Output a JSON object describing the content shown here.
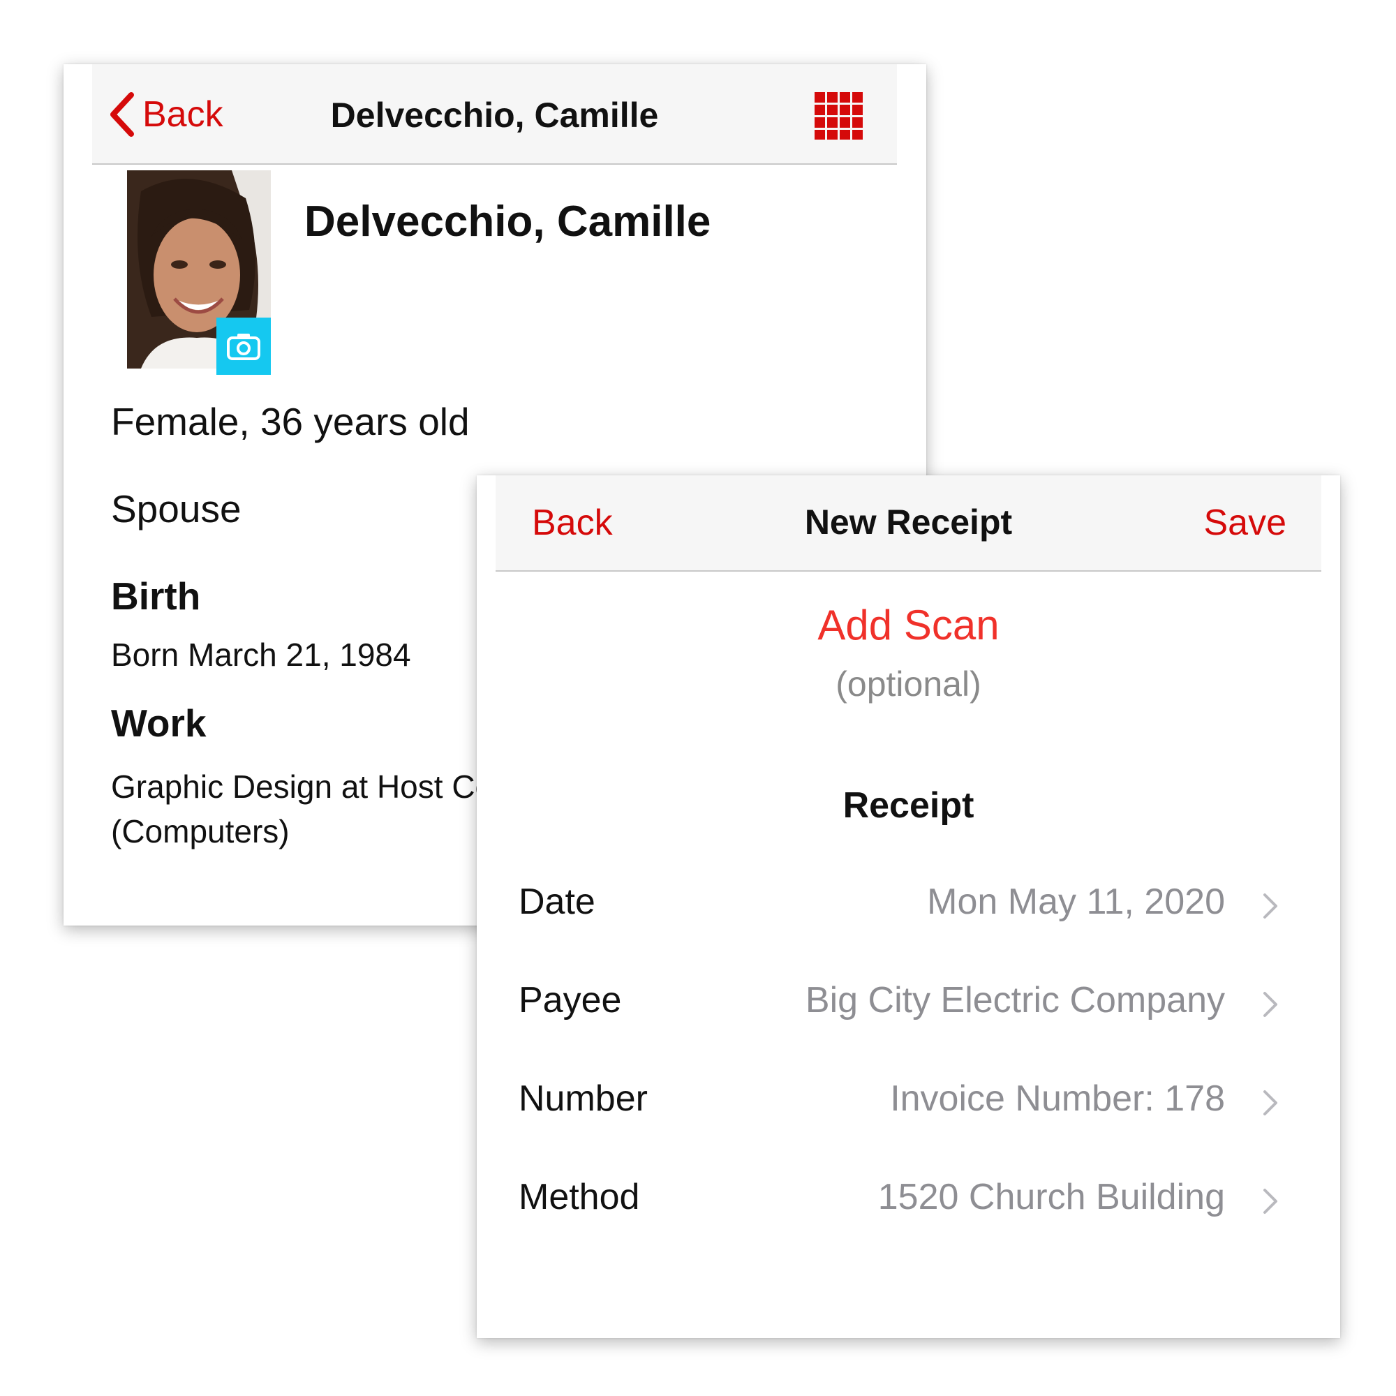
{
  "profile": {
    "navbar": {
      "back_label": "Back",
      "title": "Delvecchio, Camille",
      "menu_icon": "grid-icon"
    },
    "name": "Delvecchio, Camille",
    "gender_age": "Female, 36 years old",
    "relationship": "Spouse",
    "birth": {
      "heading": "Birth",
      "text": "Born March 21, 1984"
    },
    "work": {
      "heading": "Work",
      "line1": "Graphic Design at Host Computers",
      "line2": "(Computers)"
    }
  },
  "receipt": {
    "navbar": {
      "back_label": "Back",
      "title": "New Receipt",
      "save_label": "Save"
    },
    "add_scan": "Add Scan",
    "optional": "(optional)",
    "section_title": "Receipt",
    "rows": [
      {
        "label": "Date",
        "value": "Mon May 11, 2020"
      },
      {
        "label": "Payee",
        "value": "Big City Electric Company"
      },
      {
        "label": "Number",
        "value": "Invoice Number: 178"
      },
      {
        "label": "Method",
        "value": "1520 Church Building"
      }
    ]
  },
  "colors": {
    "accent_red": "#d50a0a",
    "scan_red": "#f0312a",
    "camera_badge": "#15c8f0",
    "secondary_text": "#8e8e93"
  }
}
